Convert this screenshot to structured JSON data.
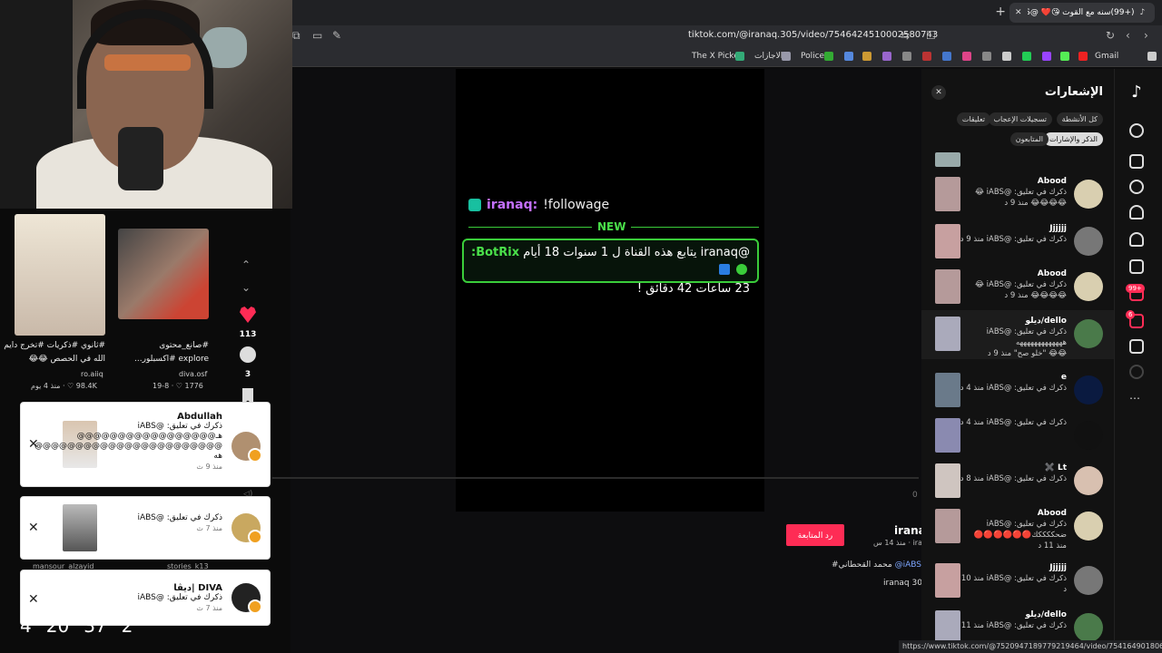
{
  "browser": {
    "tab_title": "(+99)سنه مع القوت 😘❤️ @iABS",
    "url": "tiktok.com/@iranaq.305/video/7546424510002580743",
    "bookmarks": [
      "Gmail",
      "Police",
      "الاجازات",
      "The X Picker"
    ],
    "status_url": "https://www.tiktok.com/@7520947189779219464/video/7541649018061950215"
  },
  "stream_overlay": {
    "follower_user": "iranaq:",
    "follower_cmd": "!followage",
    "new_label": "NEW",
    "bot_name": "BotRix:",
    "bot_message_line1": "@iranaq يتابع هذه القناة ل 1 سنوات 18 أيام",
    "bot_message_line2": "23 ساعات 42 دقائق !"
  },
  "video_meta": {
    "follow_label": "رد المتابعة",
    "creator": "irana",
    "creator_sub": "منذ 14 س · irar",
    "description_mention": "@iABS",
    "description_hashtag": "#محمد القحطاني",
    "sound": "iranaq 30",
    "likes": "113",
    "comments": "3"
  },
  "thumbnails": [
    {
      "caption1": "#ثانوي #ذكريات #تخرج دايم",
      "caption2": "الله في الحصص 😂😂",
      "user": "ro.aiiq",
      "stats": "98.4K ♡ · منذ 4 يوم"
    },
    {
      "caption1": "#صانع_محتوى",
      "caption2": "explore #اكسبلور...",
      "user": "diva.osf",
      "stats": "1776 ♡ · 19-8"
    }
  ],
  "popups": [
    {
      "name": "Abdullah",
      "line1": "ذكرك في تعليق: @iABS",
      "line2": "هـ@@@@@@@@@@@@@@@@@",
      "line3": "@@@@@@@@@@@@@@@@@@@@@@@",
      "line4": "هه",
      "time": "منذ 9 ث"
    },
    {
      "name": "",
      "line1": "ذكرك في تعليق: @iABS",
      "time": "منذ 7 ث"
    },
    {
      "name": "DIVA |ديڤا",
      "line1": "ذكرك في تعليق: @iABS",
      "time": "منذ 7 ث"
    }
  ],
  "clock": [
    "2",
    "37",
    "20",
    "4"
  ],
  "under_labels": [
    "mansour_alzayid",
    "stories_k13"
  ],
  "notifications": {
    "title": "الإشعارات",
    "tabs": [
      "كل الأنشطة",
      "تسجيلات الإعجاب",
      "تعليقات",
      "الذكر والإشارات",
      "المتابعون"
    ],
    "items": [
      {
        "name": "Abood",
        "line": "ذكرك في تعليق: @iABS 😂",
        "line2": "😂😂😂😂 منذ 9 د",
        "avatar": "#d9cfb0",
        "thumb": "#b59a9a"
      },
      {
        "name": "Jjjjjj",
        "line": "ذكرك في تعليق: @iABS منذ 9 د",
        "line2": "",
        "avatar": "#777",
        "thumb": "#c7a0a0"
      },
      {
        "name": "Abood",
        "line": "ذكرك في تعليق: @iABS 😂",
        "line2": "😂😂😂😂 منذ 9 د",
        "avatar": "#d9cfb0",
        "thumb": "#b59a9a"
      },
      {
        "name": "dello/ديلو",
        "line": "ذكرك في تعليق: @iABS",
        "line2": "هههههههههههههه",
        "line3": "😂😂 \"خلو صح\" منذ 9 د",
        "avatar": "#4a7a4a",
        "thumb": "#aab"
      },
      {
        "name": "e",
        "line": "ذكرك في تعليق: @iABS منذ 4 د",
        "line2": "",
        "avatar": "#0a1a40",
        "thumb": "#6a7a8a"
      },
      {
        "name": "",
        "line": "ذكرك في تعليق: @iABS منذ 4 د",
        "line2": "",
        "avatar": "#111",
        "thumb": "#8a8ab0"
      },
      {
        "name": "Lt ✖️",
        "line": "ذكرك في تعليق: @iABS منذ 8 د",
        "line2": "",
        "avatar": "#d8c0b0",
        "thumb": "#cfc5c0"
      },
      {
        "name": "Abood",
        "line": "ذكرك في تعليق: @iABS",
        "line2": "ضحككككك🔴🔴🔴🔴🔴🔴",
        "line3": "منذ 11 د",
        "avatar": "#d9cfb0",
        "thumb": "#b59a9a"
      },
      {
        "name": "Jjjjjj",
        "line": "ذكرك في تعليق: @iABS منذ 10",
        "line2": "د",
        "avatar": "#777",
        "thumb": "#c7a0a0"
      },
      {
        "name": "dello/ديلو",
        "line": "ذكرك في تعليق: @iABS منذ 11",
        "line2": "",
        "avatar": "#4a7a4a",
        "thumb": "#aab"
      }
    ]
  },
  "badges": {
    "inbox": "99+",
    "messages": "6"
  },
  "progress_time": "0"
}
